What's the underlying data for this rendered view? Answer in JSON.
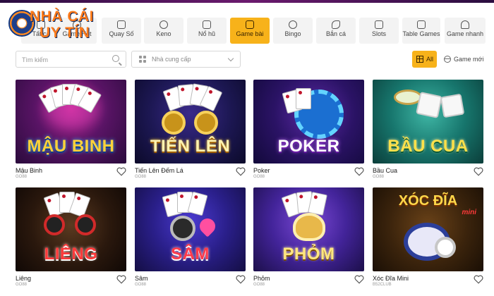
{
  "logo": {
    "line1": "NHÀ CÁI",
    "line2": "UY TÍN"
  },
  "categories": [
    {
      "label": "Tất cả",
      "icon": "all-icon",
      "active": false
    },
    {
      "label": "Game Hot",
      "icon": "fire-icon",
      "active": false
    },
    {
      "label": "Quay Số",
      "icon": "lottery-icon",
      "active": false
    },
    {
      "label": "Keno",
      "icon": "keno-icon",
      "active": false
    },
    {
      "label": "Nổ hũ",
      "icon": "slot-seven-icon",
      "active": false
    },
    {
      "label": "Game bài",
      "icon": "cards-icon",
      "active": true
    },
    {
      "label": "Bingo",
      "icon": "bingo-icon",
      "active": false
    },
    {
      "label": "Bắn cá",
      "icon": "fish-icon",
      "active": false
    },
    {
      "label": "Slots",
      "icon": "slot-machine-icon",
      "active": false
    },
    {
      "label": "Table Games",
      "icon": "table-icon",
      "active": false
    },
    {
      "label": "Game nhanh",
      "icon": "rocket-icon",
      "active": false
    }
  ],
  "filters": {
    "search_placeholder": "Tìm kiếm",
    "provider_placeholder": "Nhà cung cấp",
    "all_label": "All",
    "new_label": "Game mới"
  },
  "games": [
    {
      "name": "Mậu Binh",
      "provider": "GO88",
      "art_title": "MẬU BINH"
    },
    {
      "name": "Tiến Lên Đếm Lá",
      "provider": "GO88",
      "art_title": "TIẾN LÊN"
    },
    {
      "name": "Poker",
      "provider": "GO88",
      "art_title": "POKER"
    },
    {
      "name": "Bầu Cua",
      "provider": "GO88",
      "art_title": "BẦU CUA"
    },
    {
      "name": "Liêng",
      "provider": "GO88",
      "art_title": "LIÊNG"
    },
    {
      "name": "Sâm",
      "provider": "GO88",
      "art_title": "SÂM"
    },
    {
      "name": "Phỏm",
      "provider": "GO88",
      "art_title": "PHỎM"
    },
    {
      "name": "Xóc Đĩa Mini",
      "provider": "B52CLUB",
      "art_title": "XÓC ĐĨA",
      "art_sub": "mini"
    }
  ]
}
